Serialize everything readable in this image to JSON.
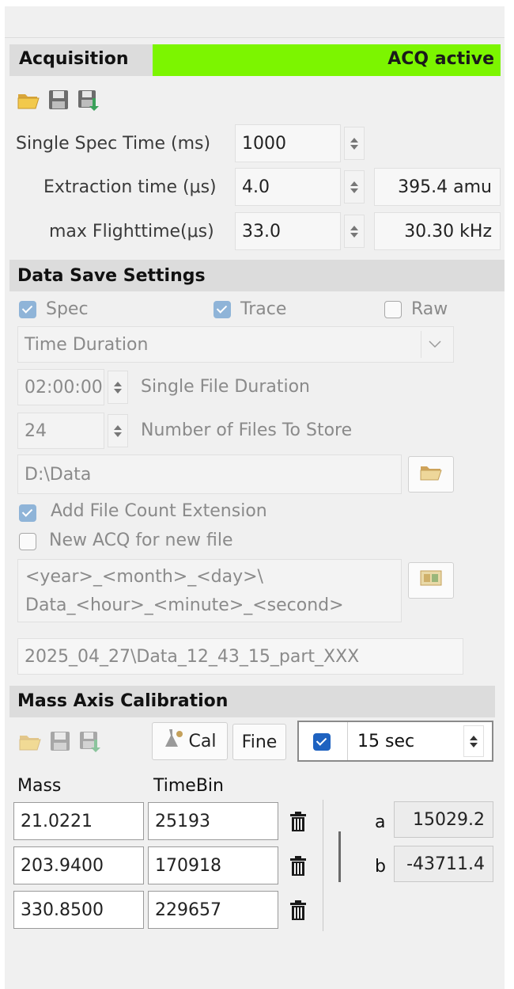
{
  "acquisition": {
    "title": "Acquisition",
    "status": "ACQ active",
    "status_color": "#7cf500",
    "toolbar": [
      "open-folder-icon",
      "save-icon",
      "save-as-icon"
    ],
    "single_spec": {
      "label": "Single Spec Time (ms)",
      "value": "1000"
    },
    "extraction": {
      "label": "Extraction time (μs)",
      "value": "4.0",
      "readout": "395.4 amu"
    },
    "flighttime": {
      "label": "max Flighttime(μs)",
      "value": "33.0",
      "readout": "30.30 kHz"
    }
  },
  "data_save": {
    "title": "Data Save Settings",
    "spec": {
      "label": "Spec",
      "checked": true
    },
    "trace": {
      "label": "Trace",
      "checked": true
    },
    "raw": {
      "label": "Raw",
      "checked": false
    },
    "mode_select": "Time Duration",
    "file_duration": {
      "value": "02:00:00",
      "label": "Single File Duration"
    },
    "file_count": {
      "value": "24",
      "label": "Number of Files To Store"
    },
    "path": "D:\\Data",
    "add_count_ext": {
      "label": "Add File Count Extension",
      "checked": true
    },
    "new_acq": {
      "label": "New ACQ for new file",
      "checked": false
    },
    "pattern_line1": "<year>_<month>_<day>\\",
    "pattern_line2": "Data_<hour>_<minute>_<second>",
    "preview": "2025_04_27\\Data_12_43_15_part_XXX"
  },
  "calibration": {
    "title": "Mass Axis Calibration",
    "cal_label": "Cal",
    "fine_label": "Fine",
    "auto_checked": true,
    "interval": "15 sec",
    "col_mass": "Mass",
    "col_timebin": "TimeBin",
    "rows": [
      {
        "mass": "21.0221",
        "timebin": "25193"
      },
      {
        "mass": "203.9400",
        "timebin": "170918"
      },
      {
        "mass": "330.8500",
        "timebin": "229657"
      }
    ],
    "a_label": "a",
    "a_value": "15029.2",
    "b_label": "b",
    "b_value": "-43711.4"
  }
}
